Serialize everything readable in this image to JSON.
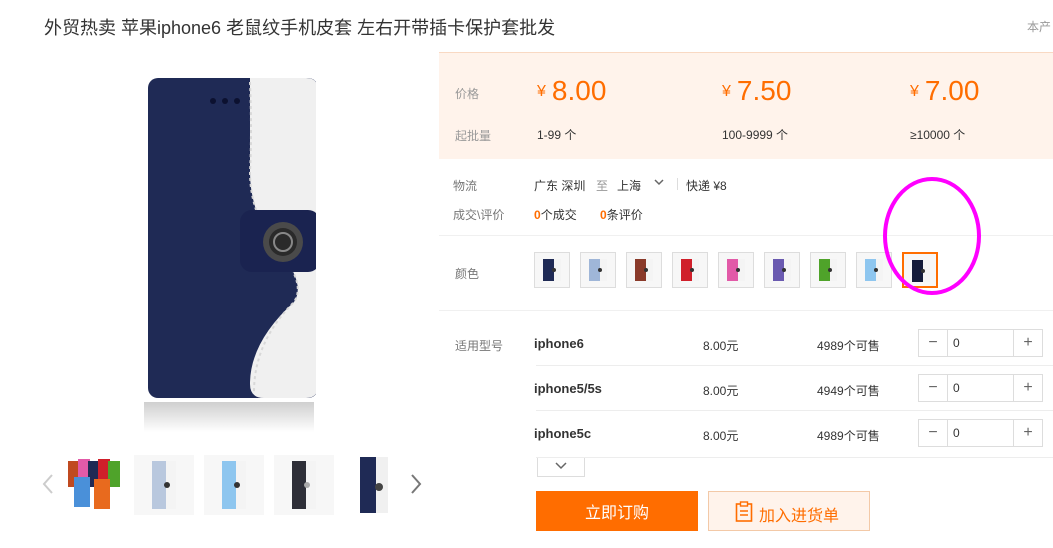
{
  "title": "外贸热卖 苹果iphone6 老鼠纹手机皮套 左右开带插卡保护套批发",
  "corner_link": "本产",
  "colors": {
    "accent": "#ff6d00",
    "price_bg": "#fff3eb",
    "case_navy": "#1f2a55",
    "case_white": "#f2f2f2",
    "annotation": "#ff00ff"
  },
  "pricing": {
    "price_label": "价格",
    "moq_label": "起批量",
    "currency": "¥",
    "tiers": [
      {
        "price": "8.00",
        "range": "1-99 个"
      },
      {
        "price": "7.50",
        "range": "100-9999 个"
      },
      {
        "price": "7.00",
        "range": "≥10000 个"
      }
    ]
  },
  "logistics": {
    "label": "物流",
    "from": "广东 深圳",
    "to_word": "至",
    "to": "上海",
    "shipping": "快递 ¥8"
  },
  "deals": {
    "label": "成交\\评价",
    "deals_count": "0",
    "deals_text": "个成交",
    "review_count": "0",
    "review_text": "条评价"
  },
  "color_options": {
    "label": "颜色",
    "swatches": [
      {
        "color": "#1f2a55",
        "selected": false
      },
      {
        "color": "#9fb6d8",
        "selected": false
      },
      {
        "color": "#8a3a2a",
        "selected": false
      },
      {
        "color": "#d01f2a",
        "selected": false
      },
      {
        "color": "#e25aa8",
        "selected": false
      },
      {
        "color": "#6a5ab0",
        "selected": false
      },
      {
        "color": "#4fa32a",
        "selected": false
      },
      {
        "color": "#8ec6ef",
        "selected": false
      },
      {
        "color": "#141b3a",
        "selected": true
      }
    ]
  },
  "models": {
    "label": "适用型号",
    "rows": [
      {
        "name": "iphone6",
        "price": "8.00元",
        "stock": "4989个可售",
        "qty": "0"
      },
      {
        "name": "iphone5/5s",
        "price": "8.00元",
        "stock": "4949个可售",
        "qty": "0"
      },
      {
        "name": "iphone5c",
        "price": "8.00元",
        "stock": "4989个可售",
        "qty": "0"
      }
    ],
    "minus_symbol": "−",
    "plus_symbol": "+"
  },
  "actions": {
    "buy_now": "立即订购",
    "add_to_cart": "加入进货单"
  },
  "gallery": {
    "prev_icon": "chevron-left-icon",
    "next_icon": "chevron-right-icon",
    "thumb_count": 5
  }
}
